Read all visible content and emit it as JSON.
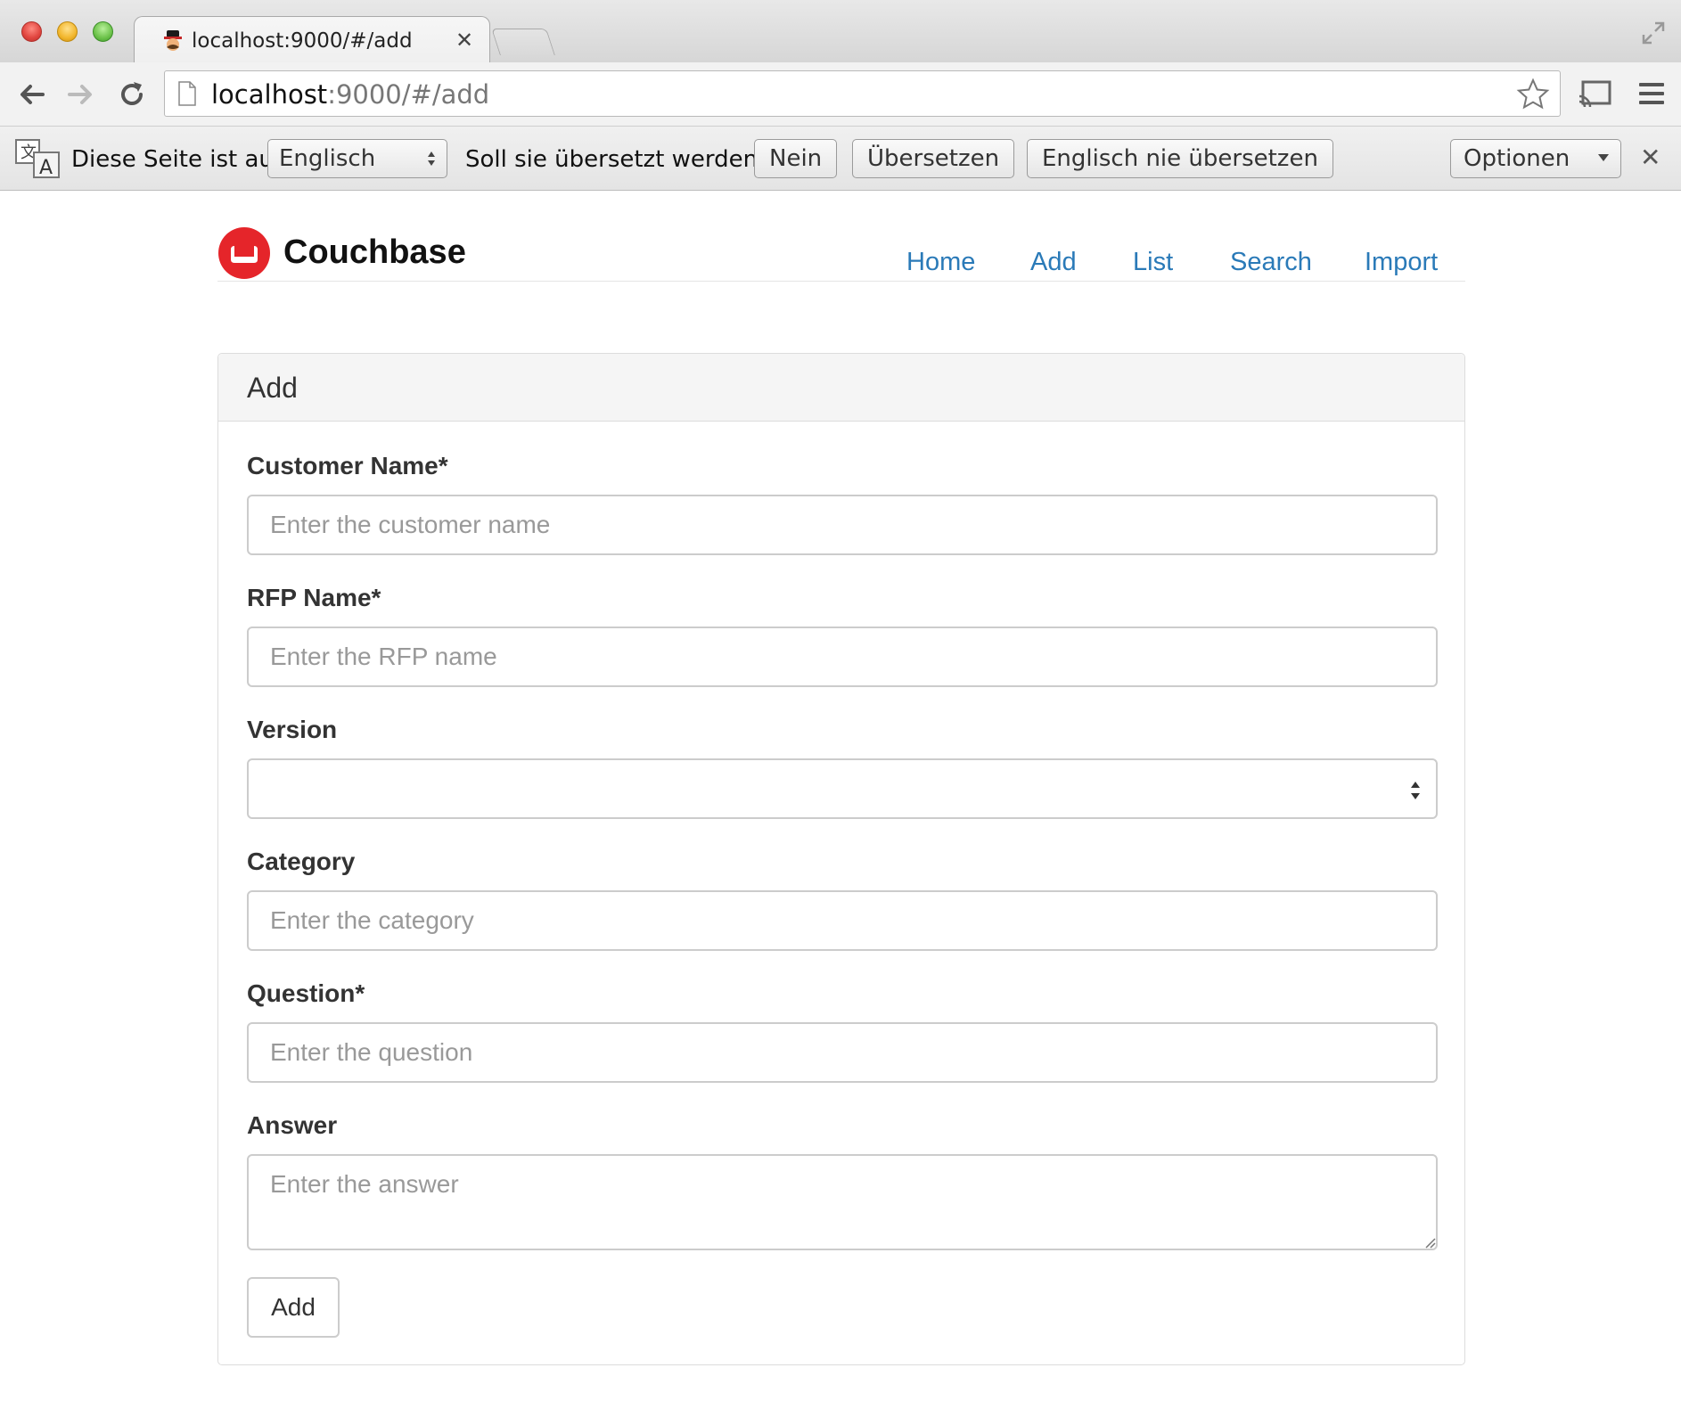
{
  "browser": {
    "tab_title": "localhost:9000/#/add",
    "url_host": "localhost",
    "url_rest": ":9000/#/add",
    "translate_bar": {
      "prefix": "Diese Seite ist auf",
      "language": "Englisch",
      "question": "Soll sie übersetzt werden?",
      "no_label": "Nein",
      "translate_label": "Übersetzen",
      "never_label": "Englisch nie übersetzen",
      "options_label": "Optionen"
    }
  },
  "navbar": {
    "brand": "Couchbase",
    "links": [
      "Home",
      "Add",
      "List",
      "Search",
      "Import"
    ]
  },
  "panel": {
    "title": "Add",
    "fields": [
      {
        "label": "Customer Name*",
        "placeholder": "Enter the customer name",
        "type": "input"
      },
      {
        "label": "RFP Name*",
        "placeholder": "Enter the RFP name",
        "type": "input"
      },
      {
        "label": "Version",
        "placeholder": "",
        "type": "select"
      },
      {
        "label": "Category",
        "placeholder": "Enter the category",
        "type": "input"
      },
      {
        "label": "Question*",
        "placeholder": "Enter the question",
        "type": "input"
      },
      {
        "label": "Answer",
        "placeholder": "Enter the answer",
        "type": "textarea"
      }
    ],
    "submit_label": "Add"
  },
  "colors": {
    "link": "#2a7ab8",
    "brand_red": "#e5252a"
  }
}
